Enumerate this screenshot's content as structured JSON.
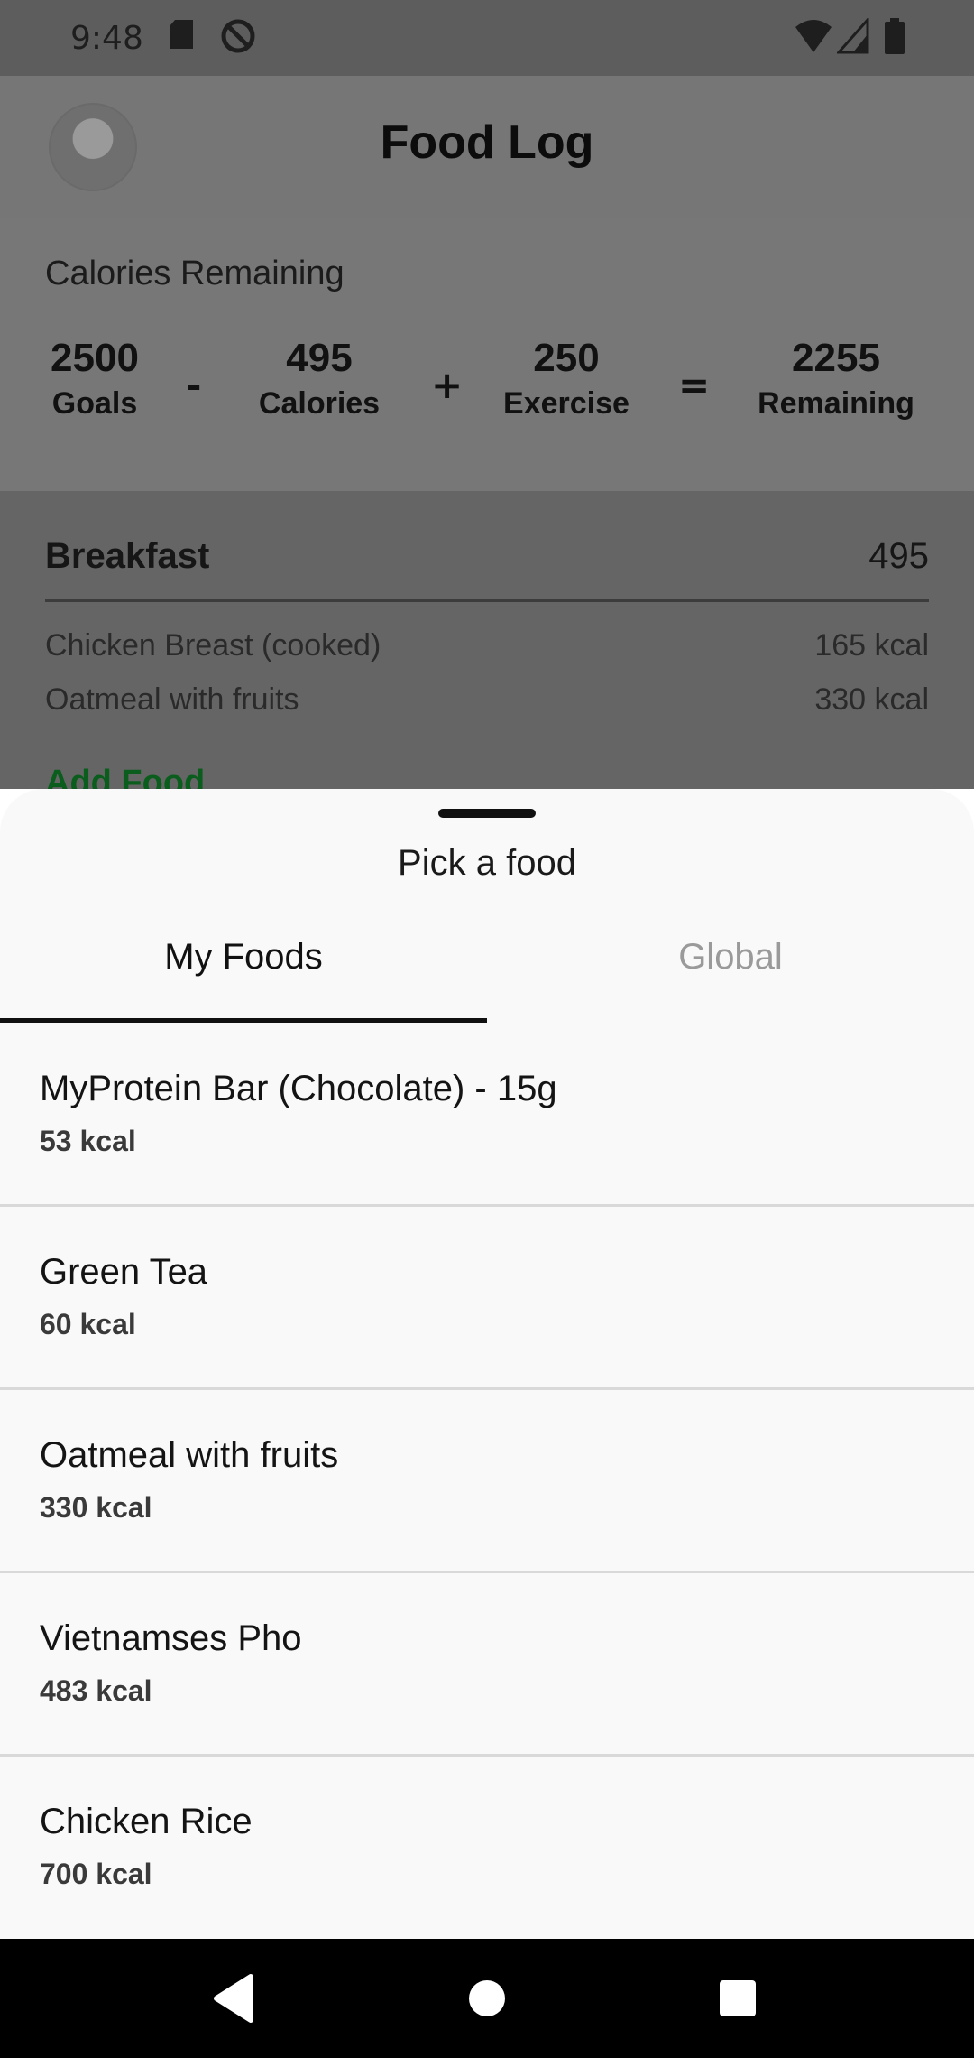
{
  "status": {
    "time": "9:48"
  },
  "appbar": {
    "title": "Food Log"
  },
  "summary": {
    "label": "Calories Remaining",
    "goals": {
      "value": "2500",
      "caption": "Goals"
    },
    "calories": {
      "value": "495",
      "caption": "Calories"
    },
    "exercise": {
      "value": "250",
      "caption": "Exercise"
    },
    "remaining": {
      "value": "2255",
      "caption": "Remaining"
    },
    "ops": {
      "minus": "-",
      "plus": "+",
      "equals": "="
    }
  },
  "meal": {
    "title": "Breakfast",
    "total": "495",
    "items": [
      {
        "name": "Chicken Breast (cooked)",
        "kcal": "165 kcal"
      },
      {
        "name": "Oatmeal with fruits",
        "kcal": "330 kcal"
      }
    ],
    "add_label": "Add Food"
  },
  "sheet": {
    "title": "Pick a food",
    "tabs": [
      {
        "label": "My Foods"
      },
      {
        "label": "Global"
      }
    ],
    "foods": [
      {
        "name": "MyProtein Bar (Chocolate) - 15g",
        "kcal": "53 kcal"
      },
      {
        "name": "Green Tea",
        "kcal": "60 kcal"
      },
      {
        "name": "Oatmeal with fruits",
        "kcal": "330 kcal"
      },
      {
        "name": "Vietnamses Pho",
        "kcal": "483 kcal"
      },
      {
        "name": "Chicken Rice",
        "kcal": "700 kcal"
      }
    ]
  },
  "colors": {
    "accent_green": "#0b5d1e",
    "scrim": "#777777",
    "sheet_bg": "#f9f9f9"
  }
}
